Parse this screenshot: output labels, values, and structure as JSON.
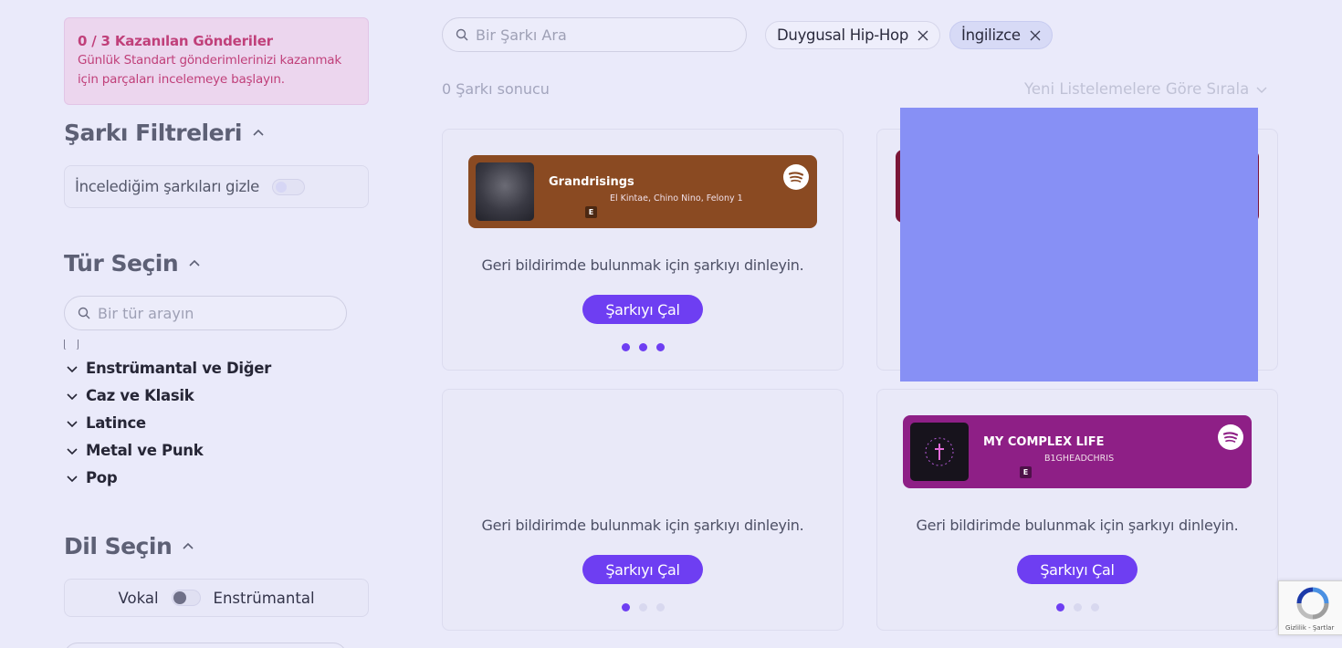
{
  "promo": {
    "title": "0 / 3 Kazanılan Gönderiler",
    "text": "Günlük Standart gönderimlerinizi kazanmak için parçaları incelemeye başlayın."
  },
  "song_filters": {
    "title": "Şarkı Filtreleri",
    "hide_reviewed_label": "İncelediğim şarkıları gizle"
  },
  "genre": {
    "title": "Tür Seçin",
    "search_placeholder": "Bir tür arayın",
    "items": [
      "Enstrümantal ve Diğer",
      "Caz ve Klasik",
      "Latince",
      "Metal ve Punk",
      "Pop"
    ]
  },
  "language": {
    "title": "Dil Seçin",
    "vocal_label": "Vokal",
    "instrumental_label": "Enstrümantal"
  },
  "search": {
    "placeholder": "Bir Şarkı Ara"
  },
  "chips": [
    "Duygusal Hip-Hop",
    "İngilizce"
  ],
  "results_text": "0 Şarkı sonucu",
  "sort_label": "Yeni Listelemelere Göre Sırala",
  "cards": [
    {
      "track_title": "Grandrisings",
      "artists": "El Kintae, Chino Nino, Felony 1",
      "explicit": "E",
      "feedback": "Geri bildirimde bulunmak için şarkıyı dinleyin.",
      "play_label": "Şarkıyı Çal"
    },
    {
      "feedback": "Geri bildirimde bulunmak için şarkıyı dinleyin.",
      "play_label": "Şarkıyı Çal"
    },
    {
      "track_title": "MY COMPLEX LIFE",
      "artists": "B1GHEADCHRIS",
      "explicit": "E",
      "feedback": "Geri bildirimde bulunmak için şarkıyı dinleyin.",
      "play_label": "Şarkıyı Çal"
    }
  ],
  "recaptcha": {
    "links": "Gizlilik - Şartlar"
  },
  "colors": {
    "accent": "#6e3ef2",
    "promo_text": "#c0407a",
    "player_brown": "#8a4a22",
    "player_purple": "#8e1f86",
    "overlay": "#8790f5"
  }
}
